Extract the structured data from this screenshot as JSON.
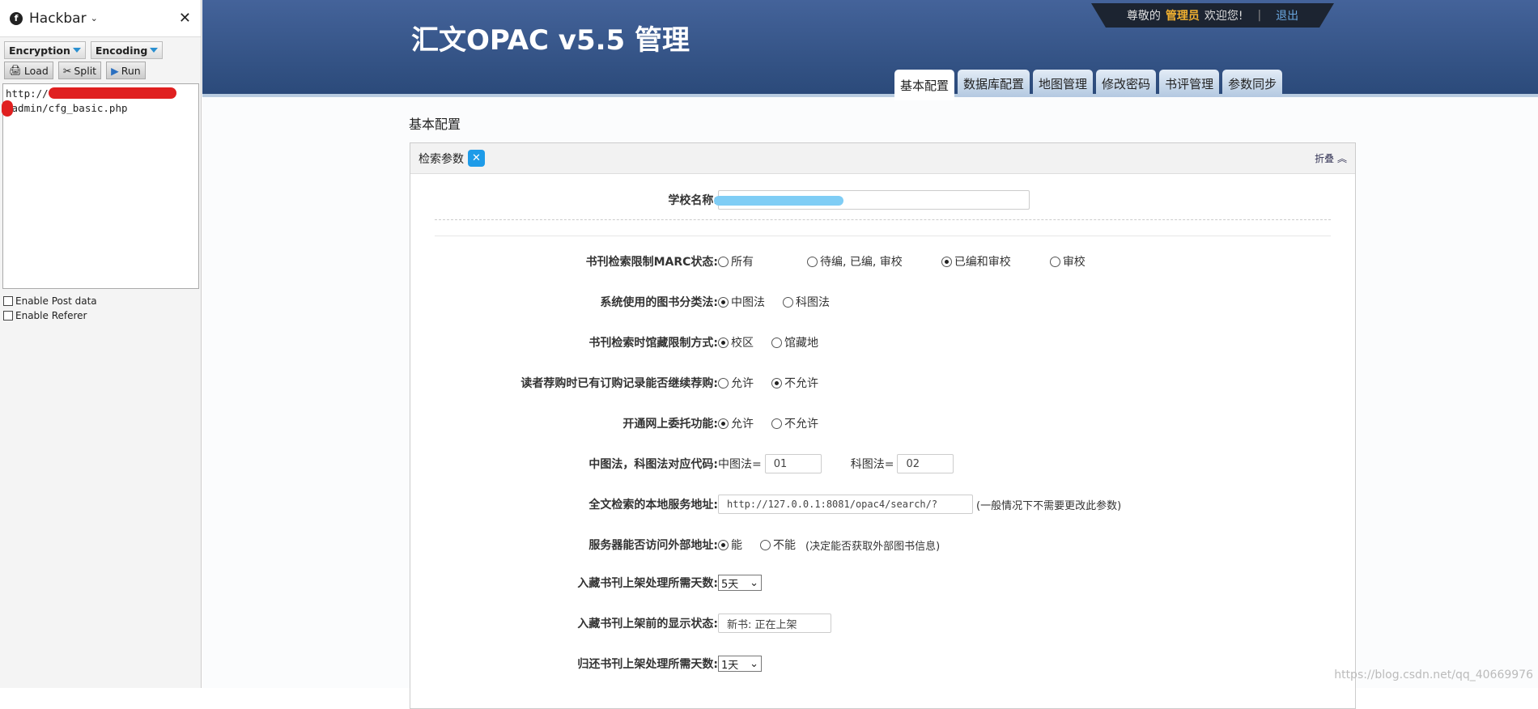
{
  "hackbar": {
    "title": "Hackbar",
    "encryption": "Encryption",
    "encoding": "Encoding",
    "load": "Load",
    "split": "Split",
    "run": "Run",
    "url_line1": "http://",
    "url_line2": "/admin/cfg_basic.php",
    "enable_post": "Enable Post data",
    "enable_referer": "Enable Referer"
  },
  "header": {
    "title": "汇文OPAC v5.5 管理",
    "welcome_prefix": "尊敬的",
    "user": "管理员",
    "welcome_suffix": "欢迎您!",
    "sep": "|",
    "logout": "退出",
    "tabs": [
      "基本配置",
      "数据库配置",
      "地图管理",
      "修改密码",
      "书评管理",
      "参数同步"
    ],
    "active_tab": 0
  },
  "page_heading": "基本配置",
  "panel": {
    "title": "检索参数",
    "fold": "折叠"
  },
  "form": {
    "school": {
      "label": "学校名称:"
    },
    "marc": {
      "label": "书刊检索限制MARC状态:",
      "options": [
        "所有",
        "待编, 已编, 审校",
        "已编和审校",
        "审校"
      ],
      "selected": 2
    },
    "classification": {
      "label": "系统使用的图书分类法:",
      "options": [
        "中图法",
        "科图法"
      ],
      "selected": 0
    },
    "holding": {
      "label": "书刊检索时馆藏限制方式:",
      "options": [
        "校区",
        "馆藏地"
      ],
      "selected": 0
    },
    "recommend": {
      "label": "读者荐购时已有订购记录能否继续荐购:",
      "options": [
        "允许",
        "不允许"
      ],
      "selected": 1
    },
    "delegate": {
      "label": "开通网上委托功能:",
      "options": [
        "允许",
        "不允许"
      ],
      "selected": 0
    },
    "codes": {
      "label": "中图法，科图法对应代码:",
      "zt_label": "中图法=",
      "zt_value": "01",
      "kt_label": "科图法=",
      "kt_value": "02"
    },
    "fulltext": {
      "label": "全文检索的本地服务地址:",
      "value": "http://127.0.0.1:8081/opac4/search/?",
      "hint": "(一般情况下不需要更改此参数)"
    },
    "external": {
      "label": "服务器能否访问外部地址:",
      "options": [
        "能",
        "不能"
      ],
      "selected": 0,
      "hint": "(决定能否获取外部图书信息)"
    },
    "shelf_days": {
      "label": "入藏书刊上架处理所需天数:",
      "value": "5天"
    },
    "shelf_status": {
      "label": "入藏书刊上架前的显示状态:",
      "value": "新书: 正在上架"
    },
    "return_days": {
      "label": "归还书刊上架处理所需天数:",
      "value": "1天"
    }
  },
  "watermark": "https://blog.csdn.net/qq_40669976"
}
